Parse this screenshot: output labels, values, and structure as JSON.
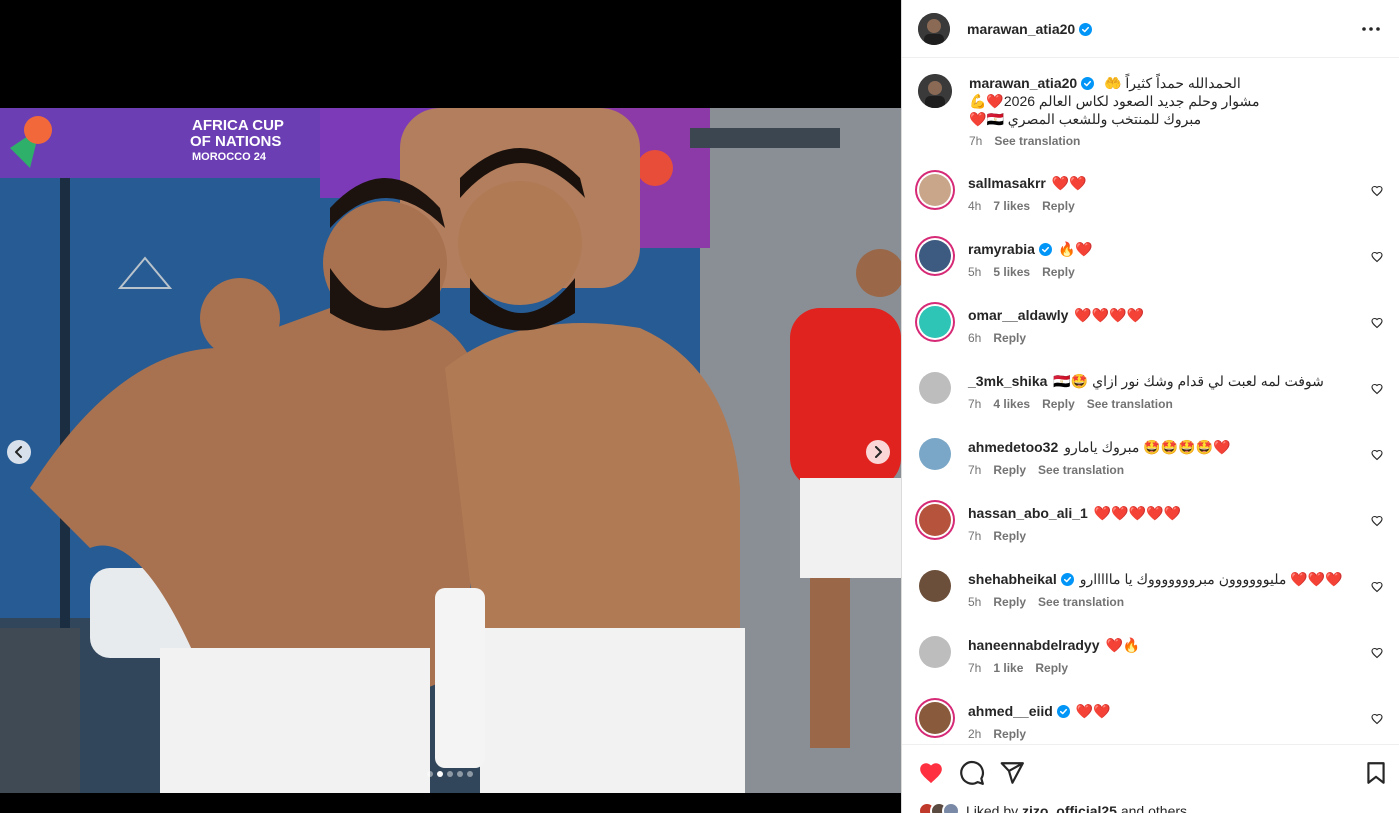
{
  "post": {
    "author": "marawan_atia20",
    "media_count": 5,
    "media_active_index": 1
  },
  "caption": {
    "username": "marawan_atia20",
    "line1": "الحمدالله حمداً كثيراً 🤲",
    "line2": "مشوار وحلم جديد الصعود لكاس العالم 2026❤️💪",
    "line3": "مبروك للمنتخب وللشعب المصري 🇪🇬❤️",
    "time": "7h",
    "translate": "See translation"
  },
  "comments": [
    {
      "username": "sallmasakrr",
      "verified": false,
      "text": "❤️❤️",
      "time": "4h",
      "likes": "7 likes",
      "reply": "Reply",
      "translate": ""
    },
    {
      "username": "ramyrabia",
      "verified": true,
      "text": "🔥❤️",
      "time": "5h",
      "likes": "5 likes",
      "reply": "Reply",
      "translate": ""
    },
    {
      "username": "omar__aldawly",
      "verified": false,
      "text": "❤️❤️❤️❤️",
      "time": "6h",
      "likes": "",
      "reply": "Reply",
      "translate": ""
    },
    {
      "username": "_3mk_shika",
      "verified": false,
      "text": "🇪🇬🤩 شوفت لمه لعبت لي قدام وشك نور ازاي",
      "time": "7h",
      "likes": "4 likes",
      "reply": "Reply",
      "translate": "See translation"
    },
    {
      "username": "ahmedetoo32",
      "verified": false,
      "text": "❤️🤩🤩🤩🤩 مبروك يامارو",
      "time": "7h",
      "likes": "",
      "reply": "Reply",
      "translate": "See translation"
    },
    {
      "username": "hassan_abo_ali_1",
      "verified": false,
      "text": "❤️❤️❤️❤️❤️",
      "time": "7h",
      "likes": "",
      "reply": "Reply",
      "translate": ""
    },
    {
      "username": "shehabheikal",
      "verified": true,
      "text": "❤️❤️❤️ مليوووووون مبروووووووك يا مااااارو",
      "time": "5h",
      "likes": "",
      "reply": "Reply",
      "translate": "See translation"
    },
    {
      "username": "haneennabdelradyy",
      "verified": false,
      "text": "❤️🔥",
      "time": "7h",
      "likes": "1 like",
      "reply": "Reply",
      "translate": ""
    },
    {
      "username": "ahmed__eiid",
      "verified": true,
      "text": "❤️❤️",
      "time": "2h",
      "likes": "",
      "reply": "Reply",
      "translate": ""
    }
  ],
  "footer": {
    "liked_prefix": "Liked by ",
    "liked_user": "zizo_official25",
    "liked_suffix": " and others"
  },
  "photo_banner": {
    "line1": "AFRICA CUP",
    "line2": "OF NATIONS",
    "line3": "MOROCCO 24"
  },
  "colors": {
    "like_red": "#ff3040",
    "verified_blue": "#0095f6",
    "story_ring": "#d62976",
    "meta_gray": "#737373"
  }
}
